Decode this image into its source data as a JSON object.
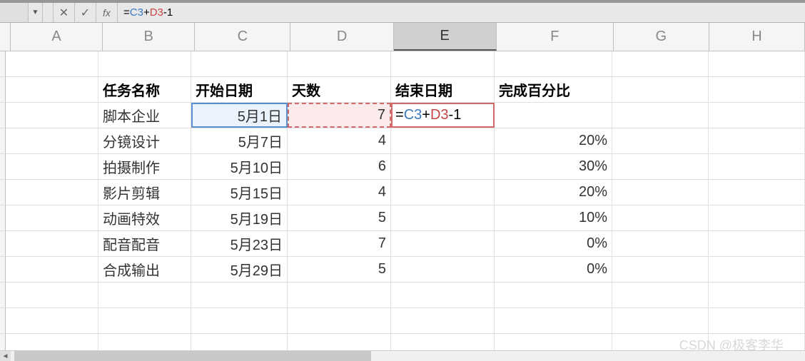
{
  "formula_bar": {
    "cancel": "✕",
    "confirm": "✓",
    "fx": "fx",
    "formula_parts": {
      "eq": "=",
      "ref1": "C3",
      "plus": "+",
      "ref2": "D3",
      "minus": "-",
      "num": "1"
    }
  },
  "columns": [
    "A",
    "B",
    "C",
    "D",
    "E",
    "F",
    "G",
    "H"
  ],
  "selected_column": "E",
  "headers": {
    "B": "任务名称",
    "C": "开始日期",
    "D": "天数",
    "E": "结束日期",
    "F": "完成百分比"
  },
  "rows": [
    {
      "B": "脚本企业",
      "C": "5月1日",
      "D": "7",
      "E_editing": {
        "eq": "=",
        "ref1": "C3",
        "plus": "+",
        "ref2": "D3",
        "minus": "-",
        "num": "1"
      },
      "F": ""
    },
    {
      "B": "分镜设计",
      "C": "5月7日",
      "D": "4",
      "E": "",
      "F": "20%"
    },
    {
      "B": "拍摄制作",
      "C": "5月10日",
      "D": "6",
      "E": "",
      "F": "30%"
    },
    {
      "B": "影片剪辑",
      "C": "5月15日",
      "D": "4",
      "E": "",
      "F": "20%"
    },
    {
      "B": "动画特效",
      "C": "5月19日",
      "D": "5",
      "E": "",
      "F": "10%"
    },
    {
      "B": "配音配音",
      "C": "5月23日",
      "D": "7",
      "E": "",
      "F": "0%"
    },
    {
      "B": "合成输出",
      "C": "5月29日",
      "D": "5",
      "E": "",
      "F": "0%"
    }
  ],
  "watermark": "CSDN @极客李华"
}
